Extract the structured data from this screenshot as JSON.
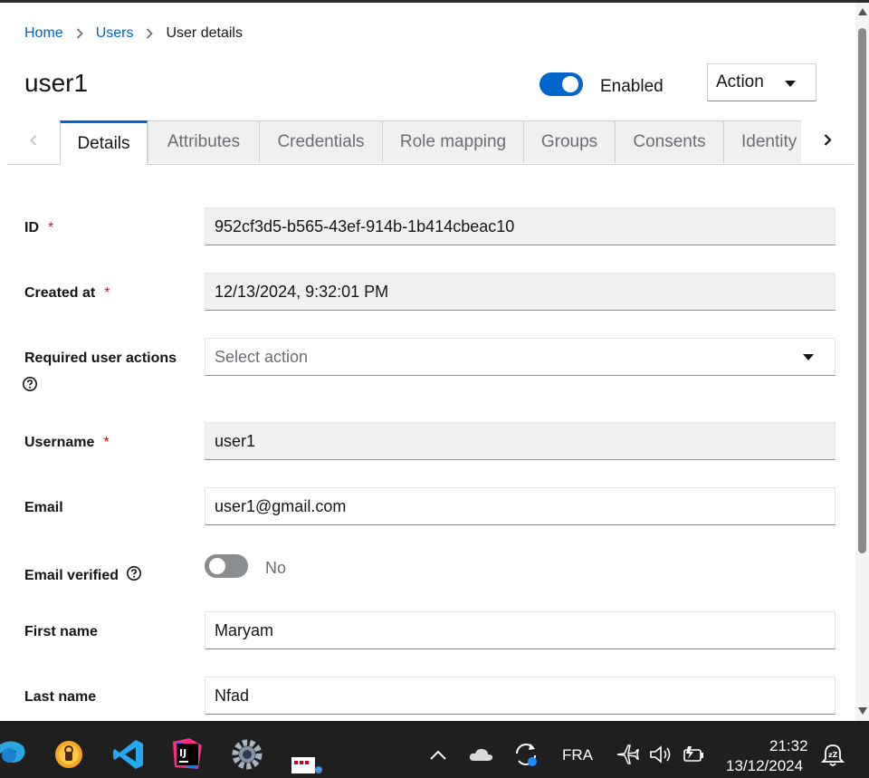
{
  "breadcrumb": {
    "home": "Home",
    "users": "Users",
    "current": "User details"
  },
  "page": {
    "title": "user1",
    "enabled_label": "Enabled",
    "enabled": true,
    "action_label": "Action"
  },
  "tabs": [
    {
      "label": "Details",
      "active": true
    },
    {
      "label": "Attributes"
    },
    {
      "label": "Credentials"
    },
    {
      "label": "Role mapping"
    },
    {
      "label": "Groups"
    },
    {
      "label": "Consents"
    },
    {
      "label": "Identity"
    }
  ],
  "form": {
    "id": {
      "label": "ID",
      "required": "*",
      "value": "952cf3d5-b565-43ef-914b-1b414cbeac10"
    },
    "created_at": {
      "label": "Created at",
      "required": "*",
      "value": "12/13/2024, 9:32:01 PM"
    },
    "required_actions": {
      "label": "Required user actions",
      "placeholder": "Select action"
    },
    "username": {
      "label": "Username",
      "required": "*",
      "value": "user1"
    },
    "email": {
      "label": "Email",
      "value": "user1@gmail.com"
    },
    "email_verified": {
      "label": "Email verified",
      "value_label": "No",
      "verified": false
    },
    "first_name": {
      "label": "First name",
      "value": "Maryam"
    },
    "last_name": {
      "label": "Last name",
      "value": "Nfad"
    }
  },
  "taskbar": {
    "language": "FRA",
    "time": "21:32",
    "date": "13/12/2024"
  },
  "colors": {
    "accent": "#0066cc",
    "required": "#c9190b",
    "readonly_bg": "#f0f0f0"
  },
  "icons": [
    "chevron-right-icon",
    "caret-down-icon",
    "help-icon",
    "chevron-left-icon",
    "edge-icon",
    "vpn-icon",
    "vscode-icon",
    "intellij-icon",
    "settings-icon",
    "app-icon",
    "chevron-up-icon",
    "cloud-icon",
    "sync-icon",
    "airplane-icon",
    "volume-icon",
    "battery-icon",
    "notification-icon"
  ]
}
